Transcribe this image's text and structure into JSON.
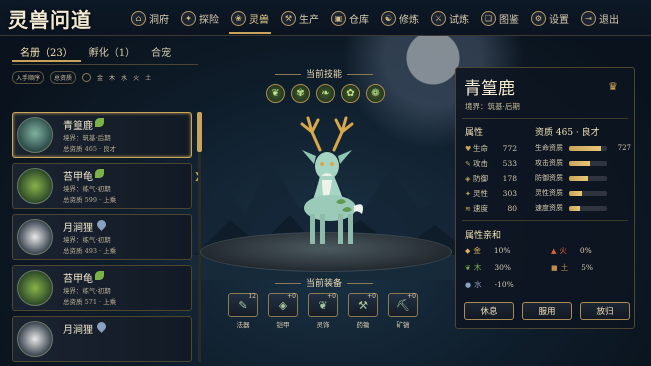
{
  "app": {
    "logo": "灵兽问道"
  },
  "nav": [
    {
      "label": "洞府",
      "icon": "⌂"
    },
    {
      "label": "探险",
      "icon": "✦"
    },
    {
      "label": "灵兽",
      "icon": "❀",
      "active": true
    },
    {
      "label": "生产",
      "icon": "⚒"
    },
    {
      "label": "仓库",
      "icon": "▣"
    },
    {
      "label": "修炼",
      "icon": "☯"
    },
    {
      "label": "试炼",
      "icon": "⚔"
    },
    {
      "label": "图鉴",
      "icon": "❏"
    },
    {
      "label": "设置",
      "icon": "⚙"
    },
    {
      "label": "退出",
      "icon": "⇥"
    }
  ],
  "left": {
    "tabs": [
      "名册（23）",
      "孵化（1）",
      "合宠"
    ],
    "filter_time": "入手顺序",
    "filter_realm": "总资质",
    "elements": [
      "金",
      "木",
      "水",
      "火",
      "土"
    ]
  },
  "beasts": [
    {
      "name": "青篁鹿",
      "element": "wood",
      "realm": "境界：筑基·后期",
      "info": "总资质 465 · 良才"
    },
    {
      "name": "苔甲龟",
      "element": "wood",
      "realm": "境界：练气·初期",
      "info": "总资质 599 · 上乘"
    },
    {
      "name": "月涧狸",
      "element": "water",
      "realm": "境界：练气·初期",
      "info": "总资质 493 · 上乘"
    },
    {
      "name": "苔甲龟",
      "element": "wood",
      "realm": "境界：练气·初期",
      "info": "总资质 571 · 上乘"
    },
    {
      "name": "月涧狸",
      "element": "water",
      "realm": "",
      "info": ""
    }
  ],
  "center": {
    "skills_title": "当前技能",
    "skills": [
      "❦",
      "✾",
      "❧",
      "✿",
      "❁"
    ],
    "equip_title": "当前装备",
    "equipment": [
      {
        "label": "法器",
        "plus": "12",
        "icon": "✎"
      },
      {
        "label": "铠甲",
        "plus": "+0",
        "icon": "◈"
      },
      {
        "label": "灵饰",
        "plus": "+0",
        "icon": "❦"
      },
      {
        "label": "药锄",
        "plus": "+0",
        "icon": "⚒"
      },
      {
        "label": "矿镐",
        "plus": "+0",
        "icon": "⛏"
      }
    ]
  },
  "detail": {
    "name": "青篁鹿",
    "realm": "境界：筑基·后期",
    "attr_title": "属性",
    "apt_title": "资质 465 · 良才",
    "stats": [
      {
        "label": "生命",
        "value": "772",
        "icon": "♥"
      },
      {
        "label": "攻击",
        "value": "533",
        "icon": "✎"
      },
      {
        "label": "防御",
        "value": "178",
        "icon": "◈"
      },
      {
        "label": "灵性",
        "value": "303",
        "icon": "✦"
      },
      {
        "label": "速度",
        "value": "80",
        "icon": "≋"
      }
    ],
    "aptitudes": [
      {
        "label": "生命资质",
        "value": "727",
        "ratio": 0.85
      },
      {
        "label": "攻击资质",
        "value": "",
        "ratio": 0.55
      },
      {
        "label": "防御资质",
        "value": "",
        "ratio": 0.5
      },
      {
        "label": "灵性资质",
        "value": "",
        "ratio": 0.35
      },
      {
        "label": "速度资质",
        "value": "",
        "ratio": 0.3
      }
    ],
    "affinity_title": "属性亲和",
    "affinity": [
      {
        "label": "金",
        "value": "10%",
        "color": "#d9b25a",
        "icon": "◆"
      },
      {
        "label": "火",
        "value": "0%",
        "color": "#e0603a",
        "icon": "▲"
      },
      {
        "label": "木",
        "value": "30%",
        "color": "#7ab248",
        "icon": "❦"
      },
      {
        "label": "土",
        "value": "5%",
        "color": "#c08a4a",
        "icon": "■"
      },
      {
        "label": "水",
        "value": "-10%",
        "color": "#8aa0c0",
        "icon": "●"
      }
    ],
    "buttons": [
      "休息",
      "服用",
      "放归"
    ]
  }
}
